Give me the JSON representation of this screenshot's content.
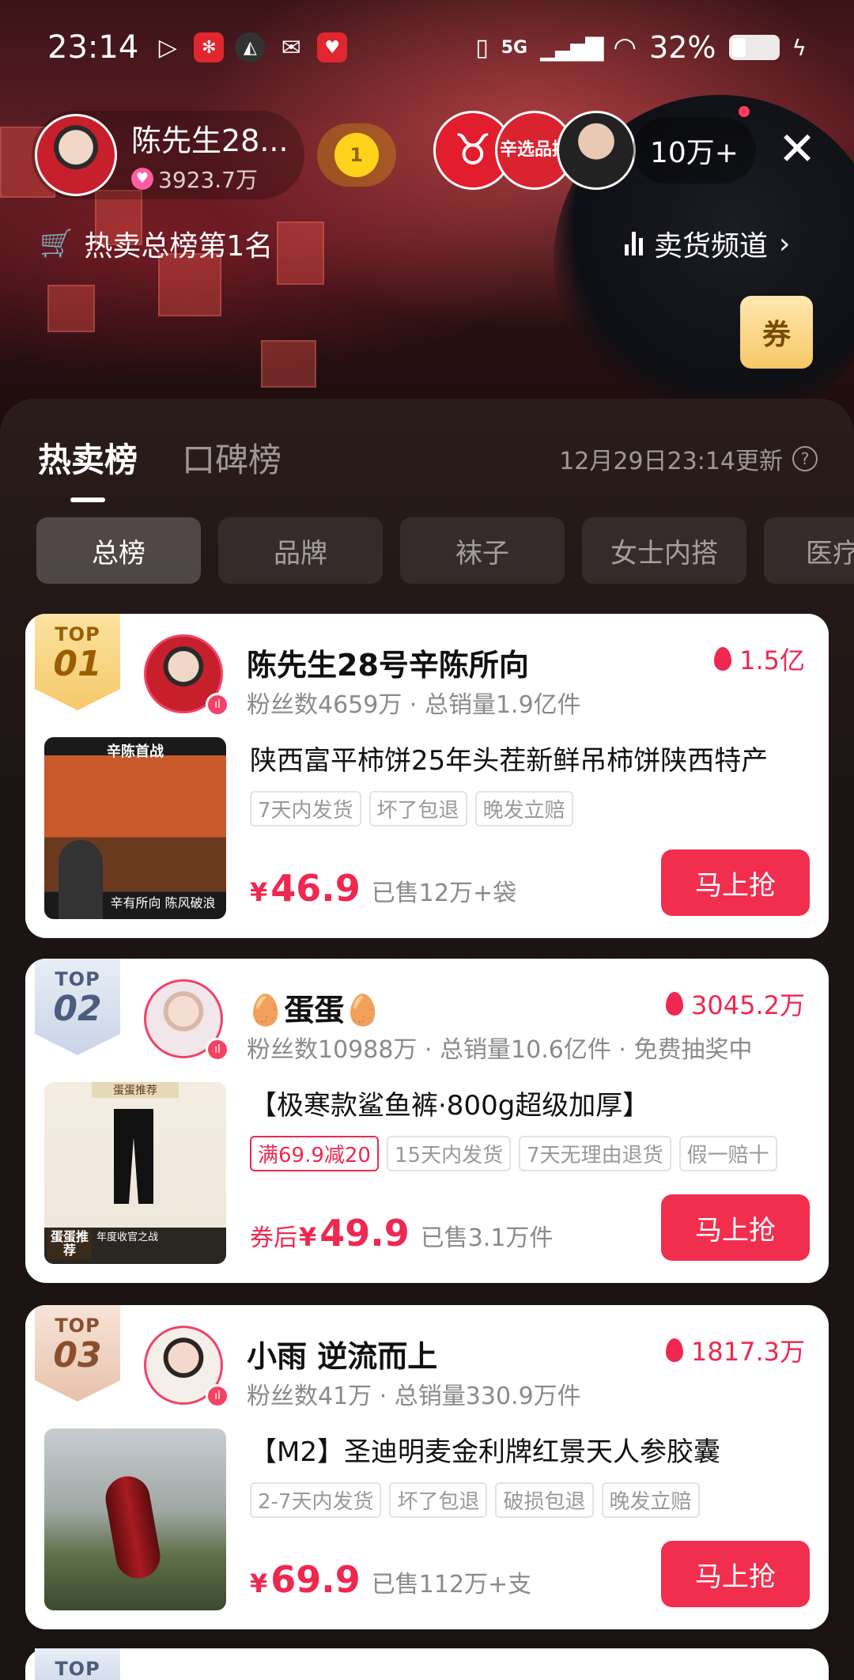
{
  "status_bar": {
    "time": "23:14",
    "network": "5G",
    "battery": "32%"
  },
  "host": {
    "name": "陈先生28...",
    "fans": "3923.7万",
    "fan_level": "1"
  },
  "viewers": {
    "badge_text": "辛选品控",
    "count": "10万+"
  },
  "hot_rank_tag": "热卖总榜第1名",
  "channel_link": "卖货频道",
  "coupon_label": "券",
  "panel": {
    "tabs": [
      "热卖榜",
      "口碑榜"
    ],
    "update_time": "12月29日23:14更新",
    "chips": [
      "总榜",
      "品牌",
      "袜子",
      "女士内搭",
      "医疗保"
    ]
  },
  "cards": [
    {
      "rank_top": "TOP",
      "rank_num": "01",
      "anchor": "陈先生28号辛陈所向",
      "stats": "粉丝数4659万 · 总销量1.9亿件",
      "heat": "1.5亿",
      "title": "陕西富平柿饼25年头茬新鲜吊柿饼陕西特产",
      "tags": [
        "7天内发货",
        "坏了包退",
        "晚发立赔"
      ],
      "price_prefix": "",
      "price_symbol": "¥",
      "price": "46.9",
      "sold": "已售12万+袋",
      "buy": "马上抢",
      "img_top_text": "辛陈首战",
      "img_bottom_text": "辛有所向 陈风破浪"
    },
    {
      "rank_top": "TOP",
      "rank_num": "02",
      "anchor": "🥚蛋蛋🥚",
      "stats": "粉丝数10988万 · 总销量10.6亿件 · 免费抽奖中",
      "heat": "3045.2万",
      "title": "【极寒款鲨鱼裤·800g超级加厚】",
      "promo_tag": "满69.9减20",
      "tags": [
        "15天内发货",
        "7天无理由退货",
        "假一赔十"
      ],
      "price_prefix": "券后",
      "price_symbol": "¥",
      "price": "49.9",
      "sold": "已售3.1万件",
      "buy": "马上抢",
      "img_top_text": "蛋蛋推荐",
      "img_badge": "蛋蛋推荐",
      "img_bottom_text": "年度收官之战"
    },
    {
      "rank_top": "TOP",
      "rank_num": "03",
      "anchor": "小雨 逆流而上",
      "stats": "粉丝数41万 · 总销量330.9万件",
      "heat": "1817.3万",
      "title": "【M2】圣迪明麦金利牌红景天人参胶囊",
      "tags": [
        "2-7天内发货",
        "坏了包退",
        "破损包退",
        "晚发立赔"
      ],
      "price_prefix": "",
      "price_symbol": "¥",
      "price": "69.9",
      "sold": "已售112万+支",
      "buy": "马上抢"
    }
  ],
  "peek_rank_top": "TOP"
}
